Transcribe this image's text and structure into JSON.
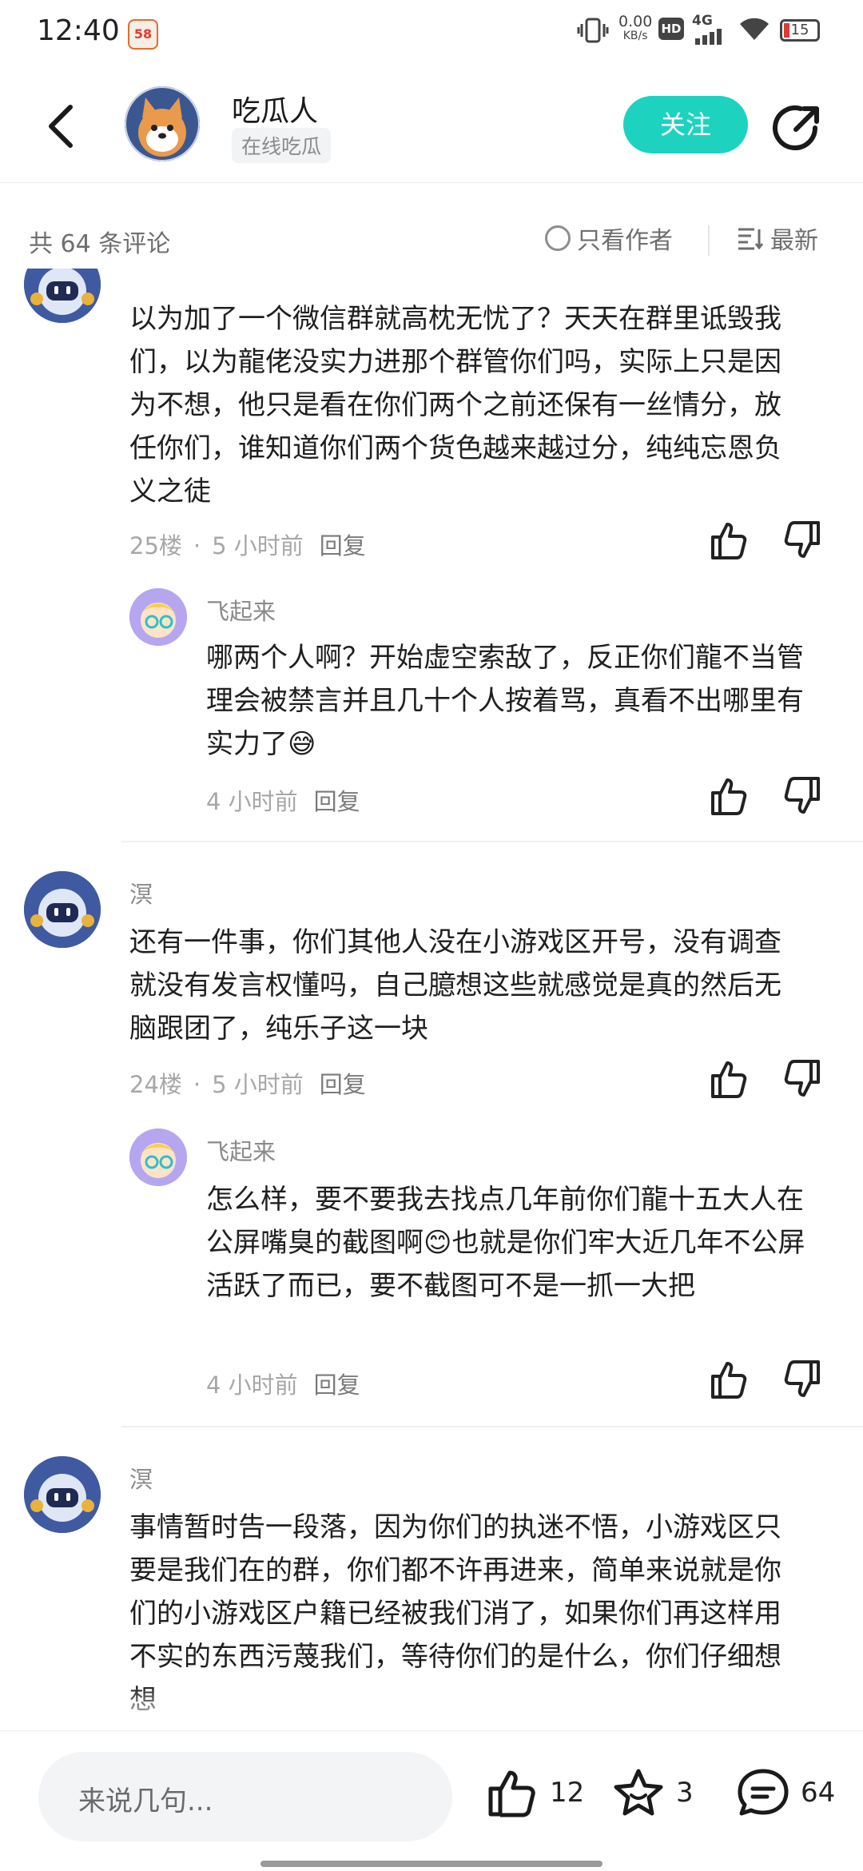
{
  "status_bar": {
    "time": "12:40",
    "app_badge": "58",
    "net_speed_value": "0.00",
    "net_speed_unit": "KB/s",
    "hd_label": "HD",
    "signal_label": "4G",
    "battery": "15"
  },
  "header": {
    "name": "吃瓜人",
    "tag": "在线吃瓜",
    "follow_label": "关注"
  },
  "toolbar": {
    "count_text": "共 64 条评论",
    "only_author": "只看作者",
    "sort": "最新"
  },
  "comments": [
    {
      "text": "以为加了一个微信群就高枕无忧了？天天在群里诋毁我们，以为龍佬没实力进那个群管你们吗，实际上只是因为不想，他只是看在你们两个之前还保有一丝情分，放任你们，谁知道你们两个货色越来越过分，纯纯忘恩负义之徒",
      "floor": "25楼",
      "time": "5 小时前",
      "reply_label": "回复",
      "sub": {
        "user": "飞起来",
        "text": "哪两个人啊？开始虚空索敌了，反正你们龍不当管理会被禁言并且几十个人按着骂，真看不出哪里有实力了😅",
        "time": "4 小时前",
        "reply_label": "回复"
      }
    },
    {
      "user": "溟",
      "text": "还有一件事，你们其他人没在小游戏区开号，没有调查就没有发言权懂吗，自己臆想这些就感觉是真的然后无脑跟团了，纯乐子这一块",
      "floor": "24楼",
      "time": "5 小时前",
      "reply_label": "回复",
      "sub": {
        "user": "飞起来",
        "text": "怎么样，要不要我去找点几年前你们龍十五大人在公屏嘴臭的截图啊😊也就是你们牢大近几年不公屏活跃了而已，要不截图可不是一抓一大把",
        "time": "4 小时前",
        "reply_label": "回复"
      }
    },
    {
      "user": "溟",
      "text": "事情暂时告一段落，因为你们的执迷不悟，小游戏区只要是我们在的群，你们都不许再进来，简单来说就是你们的小游戏区户籍已经被我们消了，如果你们再这样用不实的东西污蔑我们，等待你们的是什么，你们仔细想想"
    }
  ],
  "bottom_bar": {
    "placeholder": "来说几句...",
    "likes": "12",
    "favorites": "3",
    "comments": "64"
  },
  "colors": {
    "accent": "#1dd3c0",
    "text": "#1f1f1f",
    "muted": "#a7a7a7"
  }
}
